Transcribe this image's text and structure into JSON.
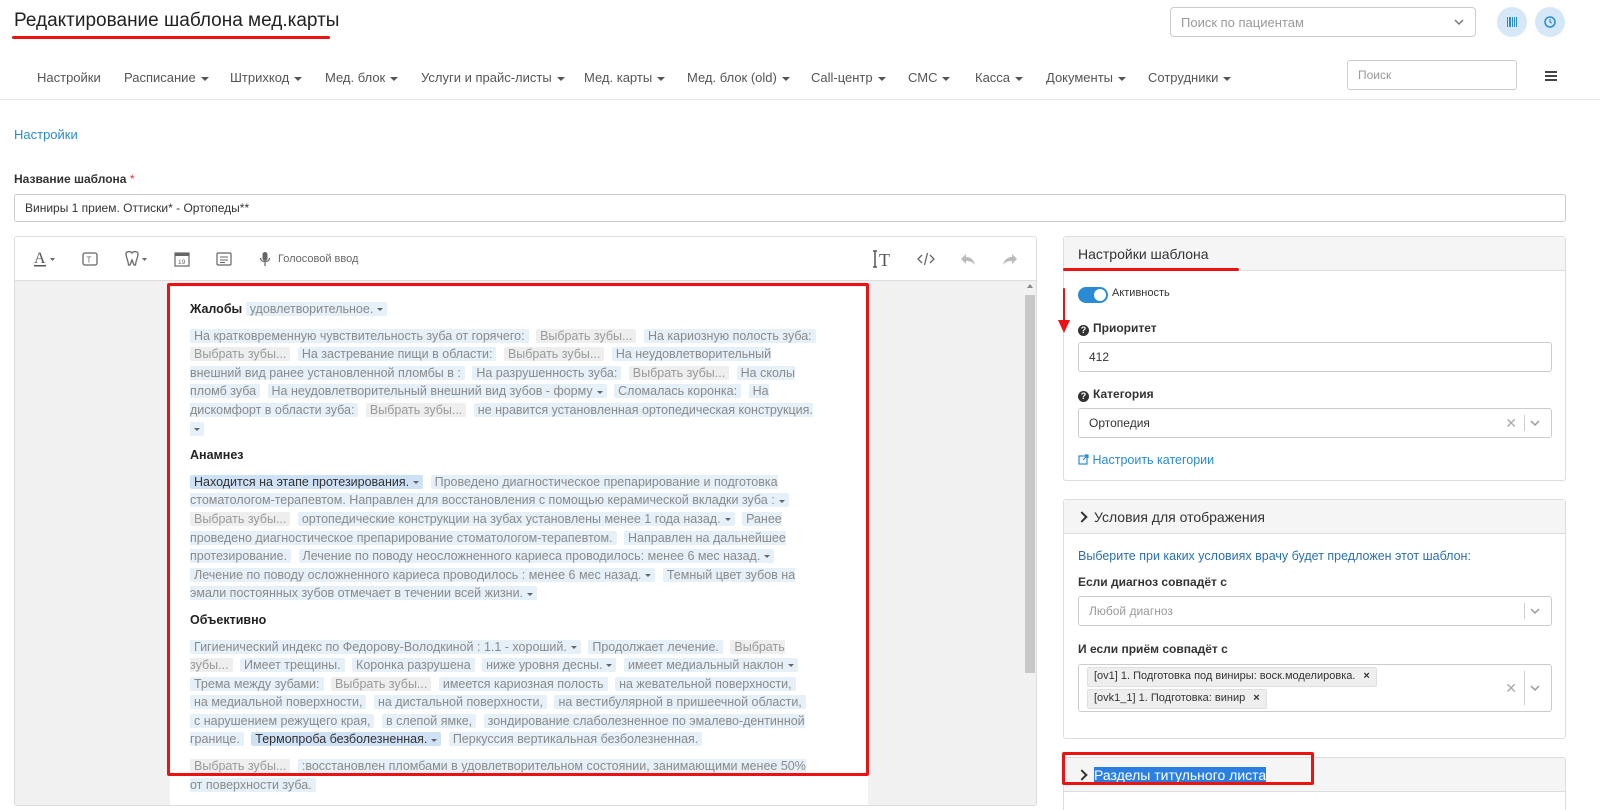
{
  "header": {
    "title": "Редактирование шаблона мед.карты",
    "patient_search_placeholder": "Поиск по пациентам"
  },
  "nav": {
    "items": [
      {
        "label": "Настройки",
        "dropdown": false
      },
      {
        "label": "Расписание",
        "dropdown": true
      },
      {
        "label": "Штрихкод",
        "dropdown": true
      },
      {
        "label": "Мед. блок",
        "dropdown": true
      },
      {
        "label": "Услуги и прайс-листы",
        "dropdown": true
      },
      {
        "label": "Мед. карты",
        "dropdown": true
      },
      {
        "label": "Мед. блок (old)",
        "dropdown": true
      },
      {
        "label": "Call-центр",
        "dropdown": true
      },
      {
        "label": "СМС",
        "dropdown": true
      },
      {
        "label": "Касса",
        "dropdown": true
      },
      {
        "label": "Документы",
        "dropdown": true
      },
      {
        "label": "Сотрудники",
        "dropdown": true
      }
    ],
    "search_placeholder": "Поиск"
  },
  "breadcrumb": "Настройки",
  "template_name": {
    "label": "Название шаблона",
    "required_mark": "*",
    "value": "Виниры 1 прием. Оттиски* - Ортопеды**"
  },
  "editor": {
    "voice_input_label": "Голосовой ввод",
    "sections": [
      {
        "title": "Жалобы",
        "inline": [
          {
            "text": "удовлетворительное.",
            "style": "light",
            "dropdown": true
          }
        ],
        "paragraphs": [
          [
            {
              "text": "На кратковременную чувствительность зуба от горячего:",
              "style": "light"
            },
            {
              "text": "Выбрать зубы...",
              "style": "gray"
            },
            {
              "text": "На кариозную полость зуба:",
              "style": "light"
            },
            {
              "text": "Выбрать зубы...",
              "style": "gray"
            },
            {
              "text": "На застревание пищи в области:",
              "style": "light"
            },
            {
              "text": "Выбрать зубы...",
              "style": "gray"
            },
            {
              "text": "На неудовлетворительный внешний вид ранее установленной пломбы в :",
              "style": "light"
            },
            {
              "text": "На разрушенность зуба:",
              "style": "light"
            },
            {
              "text": "Выбрать зубы...",
              "style": "gray"
            },
            {
              "text": "На сколы пломб зуба",
              "style": "light"
            },
            {
              "text": "На неудовлетворительный внешний вид зубов - форму",
              "style": "light",
              "dropdown": true
            },
            {
              "text": "Сломалась коронка:",
              "style": "light"
            },
            {
              "text": "На дискомфорт в области зуба:",
              "style": "light"
            },
            {
              "text": "Выбрать зубы...",
              "style": "gray"
            },
            {
              "text": "не нравится установленная ортопедическая конструкция.",
              "style": "light",
              "dropdown": true
            }
          ]
        ]
      },
      {
        "title": "Анамнез",
        "inline": [],
        "paragraphs": [
          [
            {
              "text": "Находится на этапе протезирования.",
              "style": "dark",
              "dropdown": true
            },
            {
              "text": "Проведено диагностическое препарирование и подготовка стоматологом-терапевтом. Направлен для восстановления с помощью керамической вкладки зуба :",
              "style": "light",
              "dropdown": true
            },
            {
              "text": "Выбрать зубы...",
              "style": "gray"
            },
            {
              "text": "ортопедические конструкции на зубах установлены менее 1 года назад.",
              "style": "light",
              "dropdown": true
            },
            {
              "text": "Ранее проведено диагностическое препарирование стоматологом-терапевтом.",
              "style": "light"
            },
            {
              "text": "Направлен на дальнейшее протезирование.",
              "style": "light"
            },
            {
              "text": "Лечение по поводу неосложненного кариеса проводилось: менее 6 мес назад.",
              "style": "light",
              "dropdown": true
            },
            {
              "text": "Лечение по поводу осложненного кариеса проводилось : менее 6 мес назад.",
              "style": "light",
              "dropdown": true
            },
            {
              "text": "Темный цвет зубов на эмали постоянных зубов отмечает в течении всей жизни.",
              "style": "light",
              "dropdown": true
            }
          ]
        ]
      },
      {
        "title": "Объективно",
        "inline": [],
        "paragraphs": [
          [
            {
              "text": "Гигиенический индекс по Федорову-Володкиной : 1.1 - хороший.",
              "style": "light",
              "dropdown": true
            },
            {
              "text": "Продолжает лечение.",
              "style": "light"
            },
            {
              "text": "Выбрать зубы...",
              "style": "gray"
            },
            {
              "text": "Имеет трещины.",
              "style": "light"
            },
            {
              "text": "Коронка разрушена",
              "style": "light"
            },
            {
              "text": "ниже уровня десны.",
              "style": "light",
              "dropdown": true
            },
            {
              "text": "имеет медиальный наклон",
              "style": "light",
              "dropdown": true
            },
            {
              "text": "Трема между зубами:",
              "style": "light"
            },
            {
              "text": "Выбрать зубы...",
              "style": "gray"
            },
            {
              "text": "имеется кариозная полость",
              "style": "light"
            },
            {
              "text": "на жевательной поверхности,",
              "style": "light"
            },
            {
              "text": "на медиальной поверхности,",
              "style": "light"
            },
            {
              "text": "на дистальной поверхности,",
              "style": "light"
            },
            {
              "text": "на вестибулярной в пришеечной области,",
              "style": "light"
            },
            {
              "text": "с нарушением режущего края,",
              "style": "light"
            },
            {
              "text": "в слепой ямке,",
              "style": "light"
            },
            {
              "text": "зондирование слаболезненное по эмалево-дентинной границе.",
              "style": "light"
            },
            {
              "text": "Термопроба безболезненная.",
              "style": "dark",
              "dropdown": true
            },
            {
              "text": "Перкуссия вертикальная безболезненная.",
              "style": "light"
            }
          ],
          [
            {
              "text": "Выбрать зубы...",
              "style": "gray"
            },
            {
              "text": ":восстановлен пломбами в удовлетворительном состоянии, занимающими менее 50% от поверхности зуба.",
              "style": "light"
            }
          ]
        ]
      }
    ]
  },
  "settings_panel": {
    "title": "Настройки шаблона",
    "active_label": "Активность",
    "active": true,
    "priority_label": "Приоритет",
    "priority_value": "412",
    "category_label": "Категория",
    "category_value": "Ортопедия",
    "configure_link": "Настроить категории"
  },
  "conditions_panel": {
    "title": "Условия для отображения",
    "hint": "Выберите при каких условиях врачу будет предложен этот шаблон:",
    "diagnosis_label": "Если диагноз совпадёт с",
    "diagnosis_placeholder": "Любой диагноз",
    "appointment_label": "И если приём совпадёт с",
    "appointment_tags": [
      "[ov1] 1. Подготовка под виниры: воск.моделировка.",
      "[ovk1_1] 1. Подготовка: винир"
    ]
  },
  "title_sections_panel": {
    "title": "Разделы титульного листа"
  },
  "colors": {
    "accent": "#2a8bd4",
    "annotation_red": "#ee1111",
    "chip_light": "#e6f0f9",
    "chip_dark": "#cfe1f5"
  }
}
